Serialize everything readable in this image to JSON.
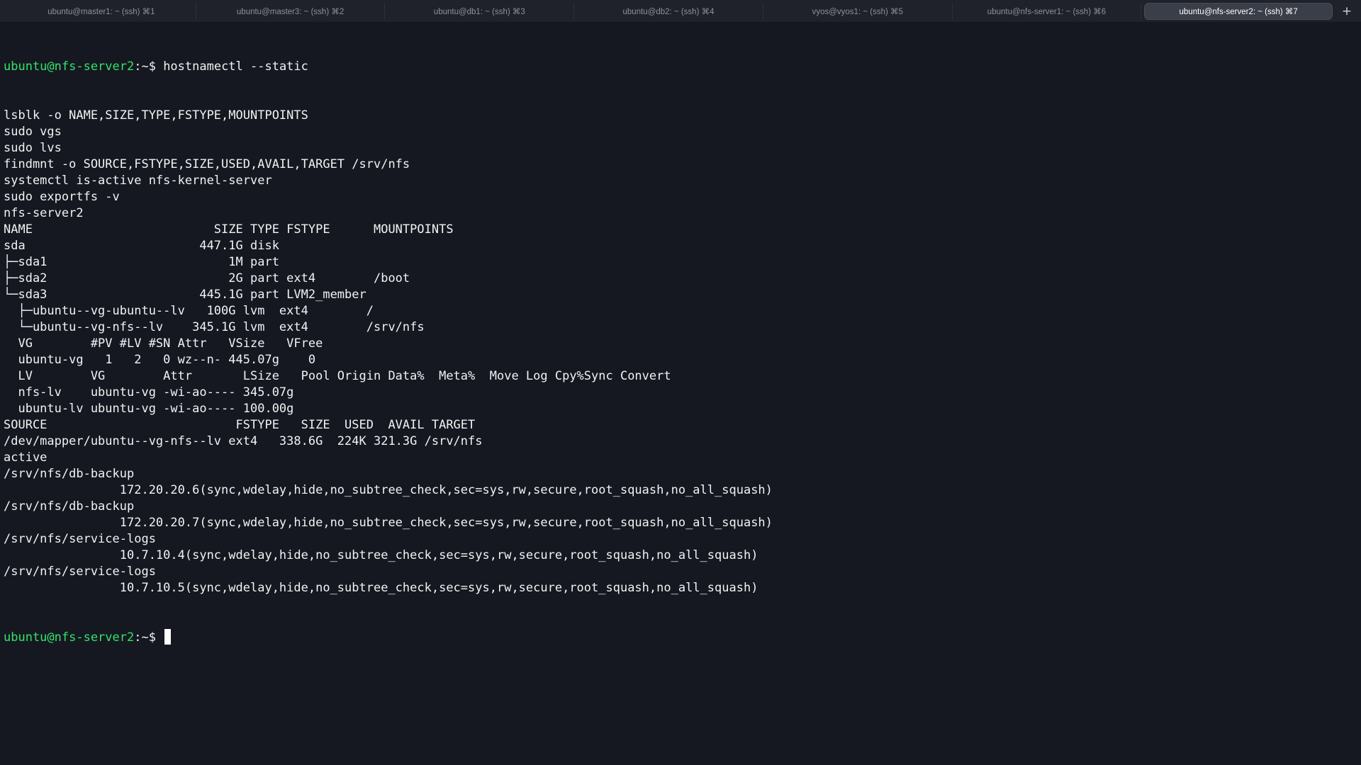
{
  "tabs": [
    {
      "label": "ubuntu@master1: ~ (ssh) ⌘1",
      "active": false
    },
    {
      "label": "ubuntu@master3: ~ (ssh) ⌘2",
      "active": false
    },
    {
      "label": "ubuntu@db1: ~ (ssh) ⌘3",
      "active": false
    },
    {
      "label": "ubuntu@db2: ~ (ssh) ⌘4",
      "active": false
    },
    {
      "label": "vyos@vyos1: ~ (ssh) ⌘5",
      "active": false
    },
    {
      "label": "ubuntu@nfs-server1: ~ (ssh) ⌘6",
      "active": false
    },
    {
      "label": "ubuntu@nfs-server2: ~ (ssh) ⌘7",
      "active": true
    }
  ],
  "new_tab_label": "+",
  "colors": {
    "background": "#151821",
    "prompt": "#33e36a",
    "text": "#f2f2f2",
    "tab_active_bg": "#3a3e48"
  },
  "terminal": {
    "prompt_user": "ubuntu@nfs-server2",
    "prompt_sep": ":~$",
    "first_command": " hostnamectl --static",
    "lines": [
      "lsblk -o NAME,SIZE,TYPE,FSTYPE,MOUNTPOINTS",
      "sudo vgs",
      "sudo lvs",
      "findmnt -o SOURCE,FSTYPE,SIZE,USED,AVAIL,TARGET /srv/nfs",
      "systemctl is-active nfs-kernel-server",
      "sudo exportfs -v",
      "nfs-server2",
      "NAME                         SIZE TYPE FSTYPE      MOUNTPOINTS",
      "sda                        447.1G disk",
      "├─sda1                         1M part",
      "├─sda2                         2G part ext4        /boot",
      "└─sda3                     445.1G part LVM2_member",
      "  ├─ubuntu--vg-ubuntu--lv   100G lvm  ext4        /",
      "  └─ubuntu--vg-nfs--lv    345.1G lvm  ext4        /srv/nfs",
      "  VG        #PV #LV #SN Attr   VSize   VFree",
      "  ubuntu-vg   1   2   0 wz--n- 445.07g    0",
      "  LV        VG        Attr       LSize   Pool Origin Data%  Meta%  Move Log Cpy%Sync Convert",
      "  nfs-lv    ubuntu-vg -wi-ao---- 345.07g",
      "  ubuntu-lv ubuntu-vg -wi-ao---- 100.00g",
      "SOURCE                          FSTYPE   SIZE  USED  AVAIL TARGET",
      "/dev/mapper/ubuntu--vg-nfs--lv ext4   338.6G  224K 321.3G /srv/nfs",
      "active",
      "/srv/nfs/db-backup",
      "                172.20.20.6(sync,wdelay,hide,no_subtree_check,sec=sys,rw,secure,root_squash,no_all_squash)",
      "/srv/nfs/db-backup",
      "                172.20.20.7(sync,wdelay,hide,no_subtree_check,sec=sys,rw,secure,root_squash,no_all_squash)",
      "/srv/nfs/service-logs",
      "                10.7.10.4(sync,wdelay,hide,no_subtree_check,sec=sys,rw,secure,root_squash,no_all_squash)",
      "/srv/nfs/service-logs",
      "                10.7.10.5(sync,wdelay,hide,no_subtree_check,sec=sys,rw,secure,root_squash,no_all_squash)"
    ],
    "final_prompt_user": "ubuntu@nfs-server2",
    "final_prompt_sep": ":~$",
    "final_input": " "
  }
}
